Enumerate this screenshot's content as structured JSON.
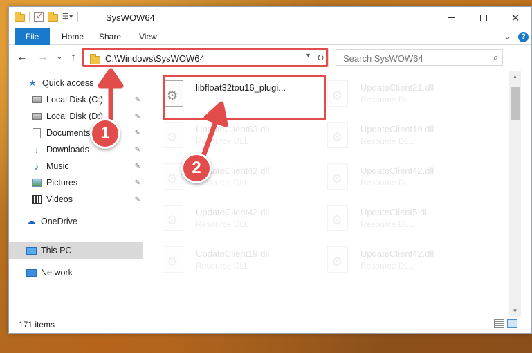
{
  "window": {
    "title": "SysWOW64",
    "controls": {
      "minimize": "",
      "maximize": "",
      "close": "✕"
    }
  },
  "ribbon": {
    "tabs": [
      "File",
      "Home",
      "Share",
      "View"
    ],
    "collapse_chevron": "⌄",
    "help": "?"
  },
  "address_bar": {
    "path": "C:\\Windows\\SysWOW64",
    "refresh": "↻",
    "dropdown": "▾"
  },
  "search": {
    "placeholder": "Search SysWOW64",
    "icon": "⌕"
  },
  "nav_buttons": {
    "back": "←",
    "forward": "→",
    "recent": "⌄",
    "up": "↑"
  },
  "sidebar": {
    "items": [
      {
        "label": "Quick access",
        "icon": "star-icon",
        "pinned": false
      },
      {
        "label": "Local Disk (C:)",
        "icon": "disk-icon",
        "pinned": true
      },
      {
        "label": "Local Disk (D:)",
        "icon": "disk-icon",
        "pinned": true
      },
      {
        "label": "Documents",
        "icon": "document-icon",
        "pinned": true
      },
      {
        "label": "Downloads",
        "icon": "download-icon",
        "pinned": true
      },
      {
        "label": "Music",
        "icon": "music-icon",
        "pinned": true
      },
      {
        "label": "Pictures",
        "icon": "pictures-icon",
        "pinned": true
      },
      {
        "label": "Videos",
        "icon": "video-icon",
        "pinned": true
      },
      {
        "label": "OneDrive",
        "icon": "cloud-icon",
        "pinned": false
      },
      {
        "label": "This PC",
        "icon": "computer-icon",
        "pinned": false
      },
      {
        "label": "Network",
        "icon": "network-icon",
        "pinned": false
      }
    ],
    "pin_glyph": "📌"
  },
  "files": {
    "left": [
      {
        "name": "libfloat32tou16_plugi...",
        "type": ""
      },
      {
        "name": "UpdateClient63.dll",
        "type": "Resource DLL"
      },
      {
        "name": "UpdateClient42.dll",
        "type": "Resource DLL"
      },
      {
        "name": "UpdateClient42.dll",
        "type": "Resource DLL"
      },
      {
        "name": "UpdateClient19.dll",
        "type": "Resource DLL"
      }
    ],
    "right": [
      {
        "name": "UpdateClient21.dll",
        "type": "Resource DLL"
      },
      {
        "name": "UpdateClient19.dll",
        "type": "Resource DLL"
      },
      {
        "name": "UpdateClient42.dll",
        "type": "Resource DLL"
      },
      {
        "name": "UpdateClient5.dll",
        "type": "Resource DLL"
      },
      {
        "name": "UpdateClient42.dll",
        "type": "Resource DLL"
      }
    ]
  },
  "status_bar": {
    "item_count": "171 items"
  },
  "annotations": {
    "step1": "1",
    "step2": "2"
  },
  "colors": {
    "accent": "#1979ca",
    "highlight": "#e24c4b",
    "selected": "#cce8ff"
  }
}
